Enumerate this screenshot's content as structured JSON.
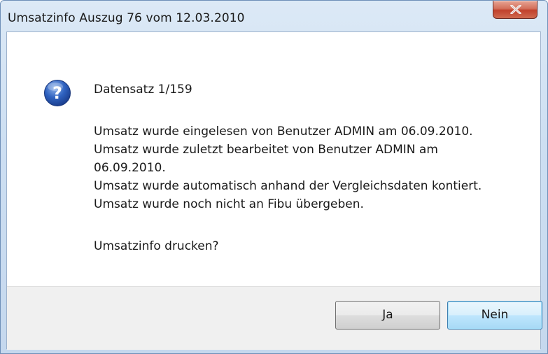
{
  "window": {
    "title": "Umsatzinfo Auszug 76 vom 12.03.2010"
  },
  "dialog": {
    "icon": "question-icon",
    "lines": [
      "Datensatz 1/159",
      "Umsatz wurde eingelesen von Benutzer ADMIN am 06.09.2010.",
      "Umsatz wurde zuletzt bearbeitet von Benutzer ADMIN am",
      "06.09.2010.",
      "Umsatz wurde automatisch anhand der Vergleichsdaten kontiert.",
      "Umsatz wurde noch nicht an Fibu übergeben.",
      "Umsatzinfo drucken?"
    ]
  },
  "buttons": {
    "yes_label": "Ja",
    "no_label": "Nein"
  },
  "colors": {
    "titlebar": "#cddff2",
    "close_button": "#c1412c",
    "default_button_border": "#3c7fb1"
  }
}
